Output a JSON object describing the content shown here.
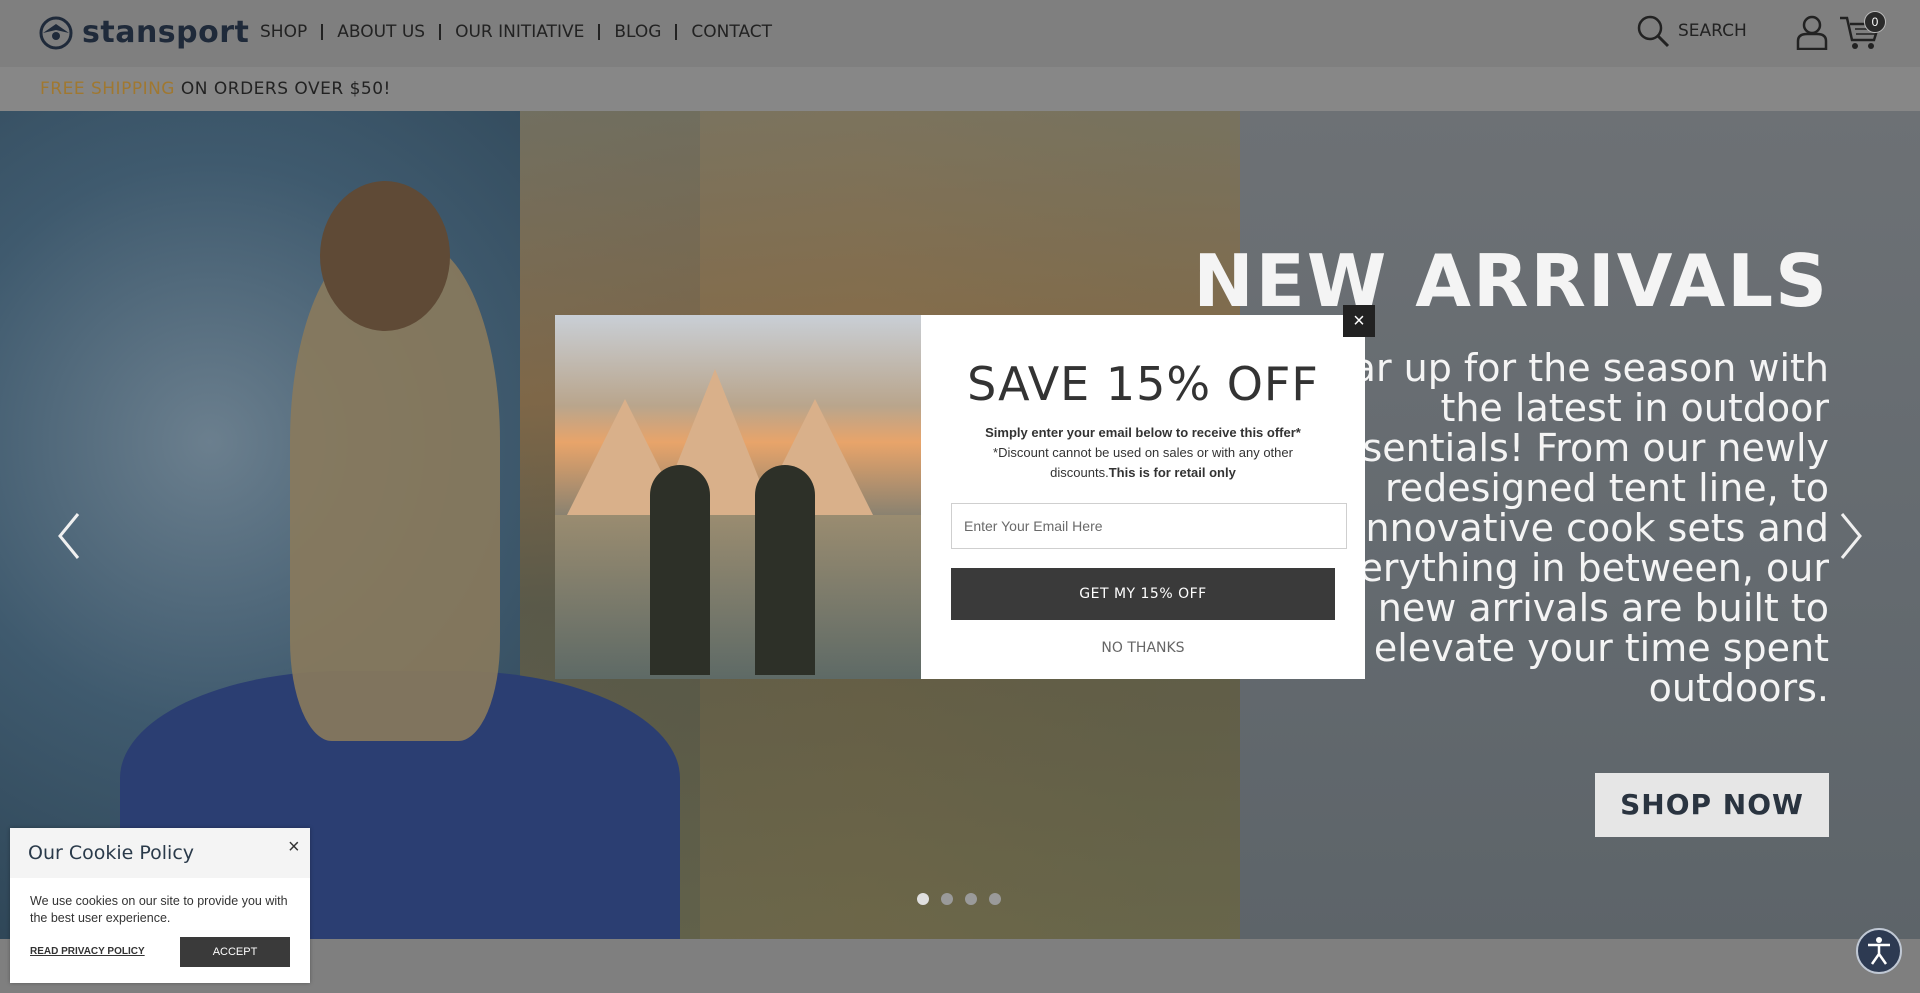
{
  "brand": {
    "name": "stansport"
  },
  "nav": {
    "items": [
      {
        "label": "SHOP"
      },
      {
        "label": "ABOUT US"
      },
      {
        "label": "OUR INITIATIVE"
      },
      {
        "label": "BLOG"
      },
      {
        "label": "CONTACT"
      }
    ]
  },
  "header": {
    "search_label": "SEARCH",
    "cart_count": "0",
    "icons": [
      "search-icon",
      "user-icon",
      "cart-icon"
    ]
  },
  "promo": {
    "accent": "FREE SHIPPING",
    "rest": " ON ORDERS OVER $50!",
    "accent_color": "#a07830"
  },
  "hero": {
    "title": "NEW ARRIVALS",
    "body": "Gear up for the season with the latest in outdoor essentials! From our newly redesigned tent line, to innovative cook sets and everything in between, our new arrivals are built to elevate your time spent outdoors.",
    "cta": "SHOP NOW",
    "slides": 4,
    "active_slide": 1
  },
  "modal": {
    "title": "SAVE 15% OFF",
    "desc_line1": "Simply enter your email below to receive this offer*",
    "desc_line2": "*Discount cannot be used on sales or with any other discounts.",
    "desc_bold": "This is for retail only",
    "email_placeholder": "Enter Your Email Here",
    "cta": "GET MY 15% OFF",
    "decline": "NO THANKS",
    "close": "×"
  },
  "cookie": {
    "title": "Our Cookie Policy",
    "body": "We use cookies on our site to provide you with the best user experience.",
    "link": "READ PRIVACY POLICY",
    "accept": "ACCEPT",
    "close": "×"
  },
  "colors": {
    "overlay": "#7f7f7f",
    "dark_button": "#3a3a3a",
    "brand_navy": "#1f2a3a"
  }
}
